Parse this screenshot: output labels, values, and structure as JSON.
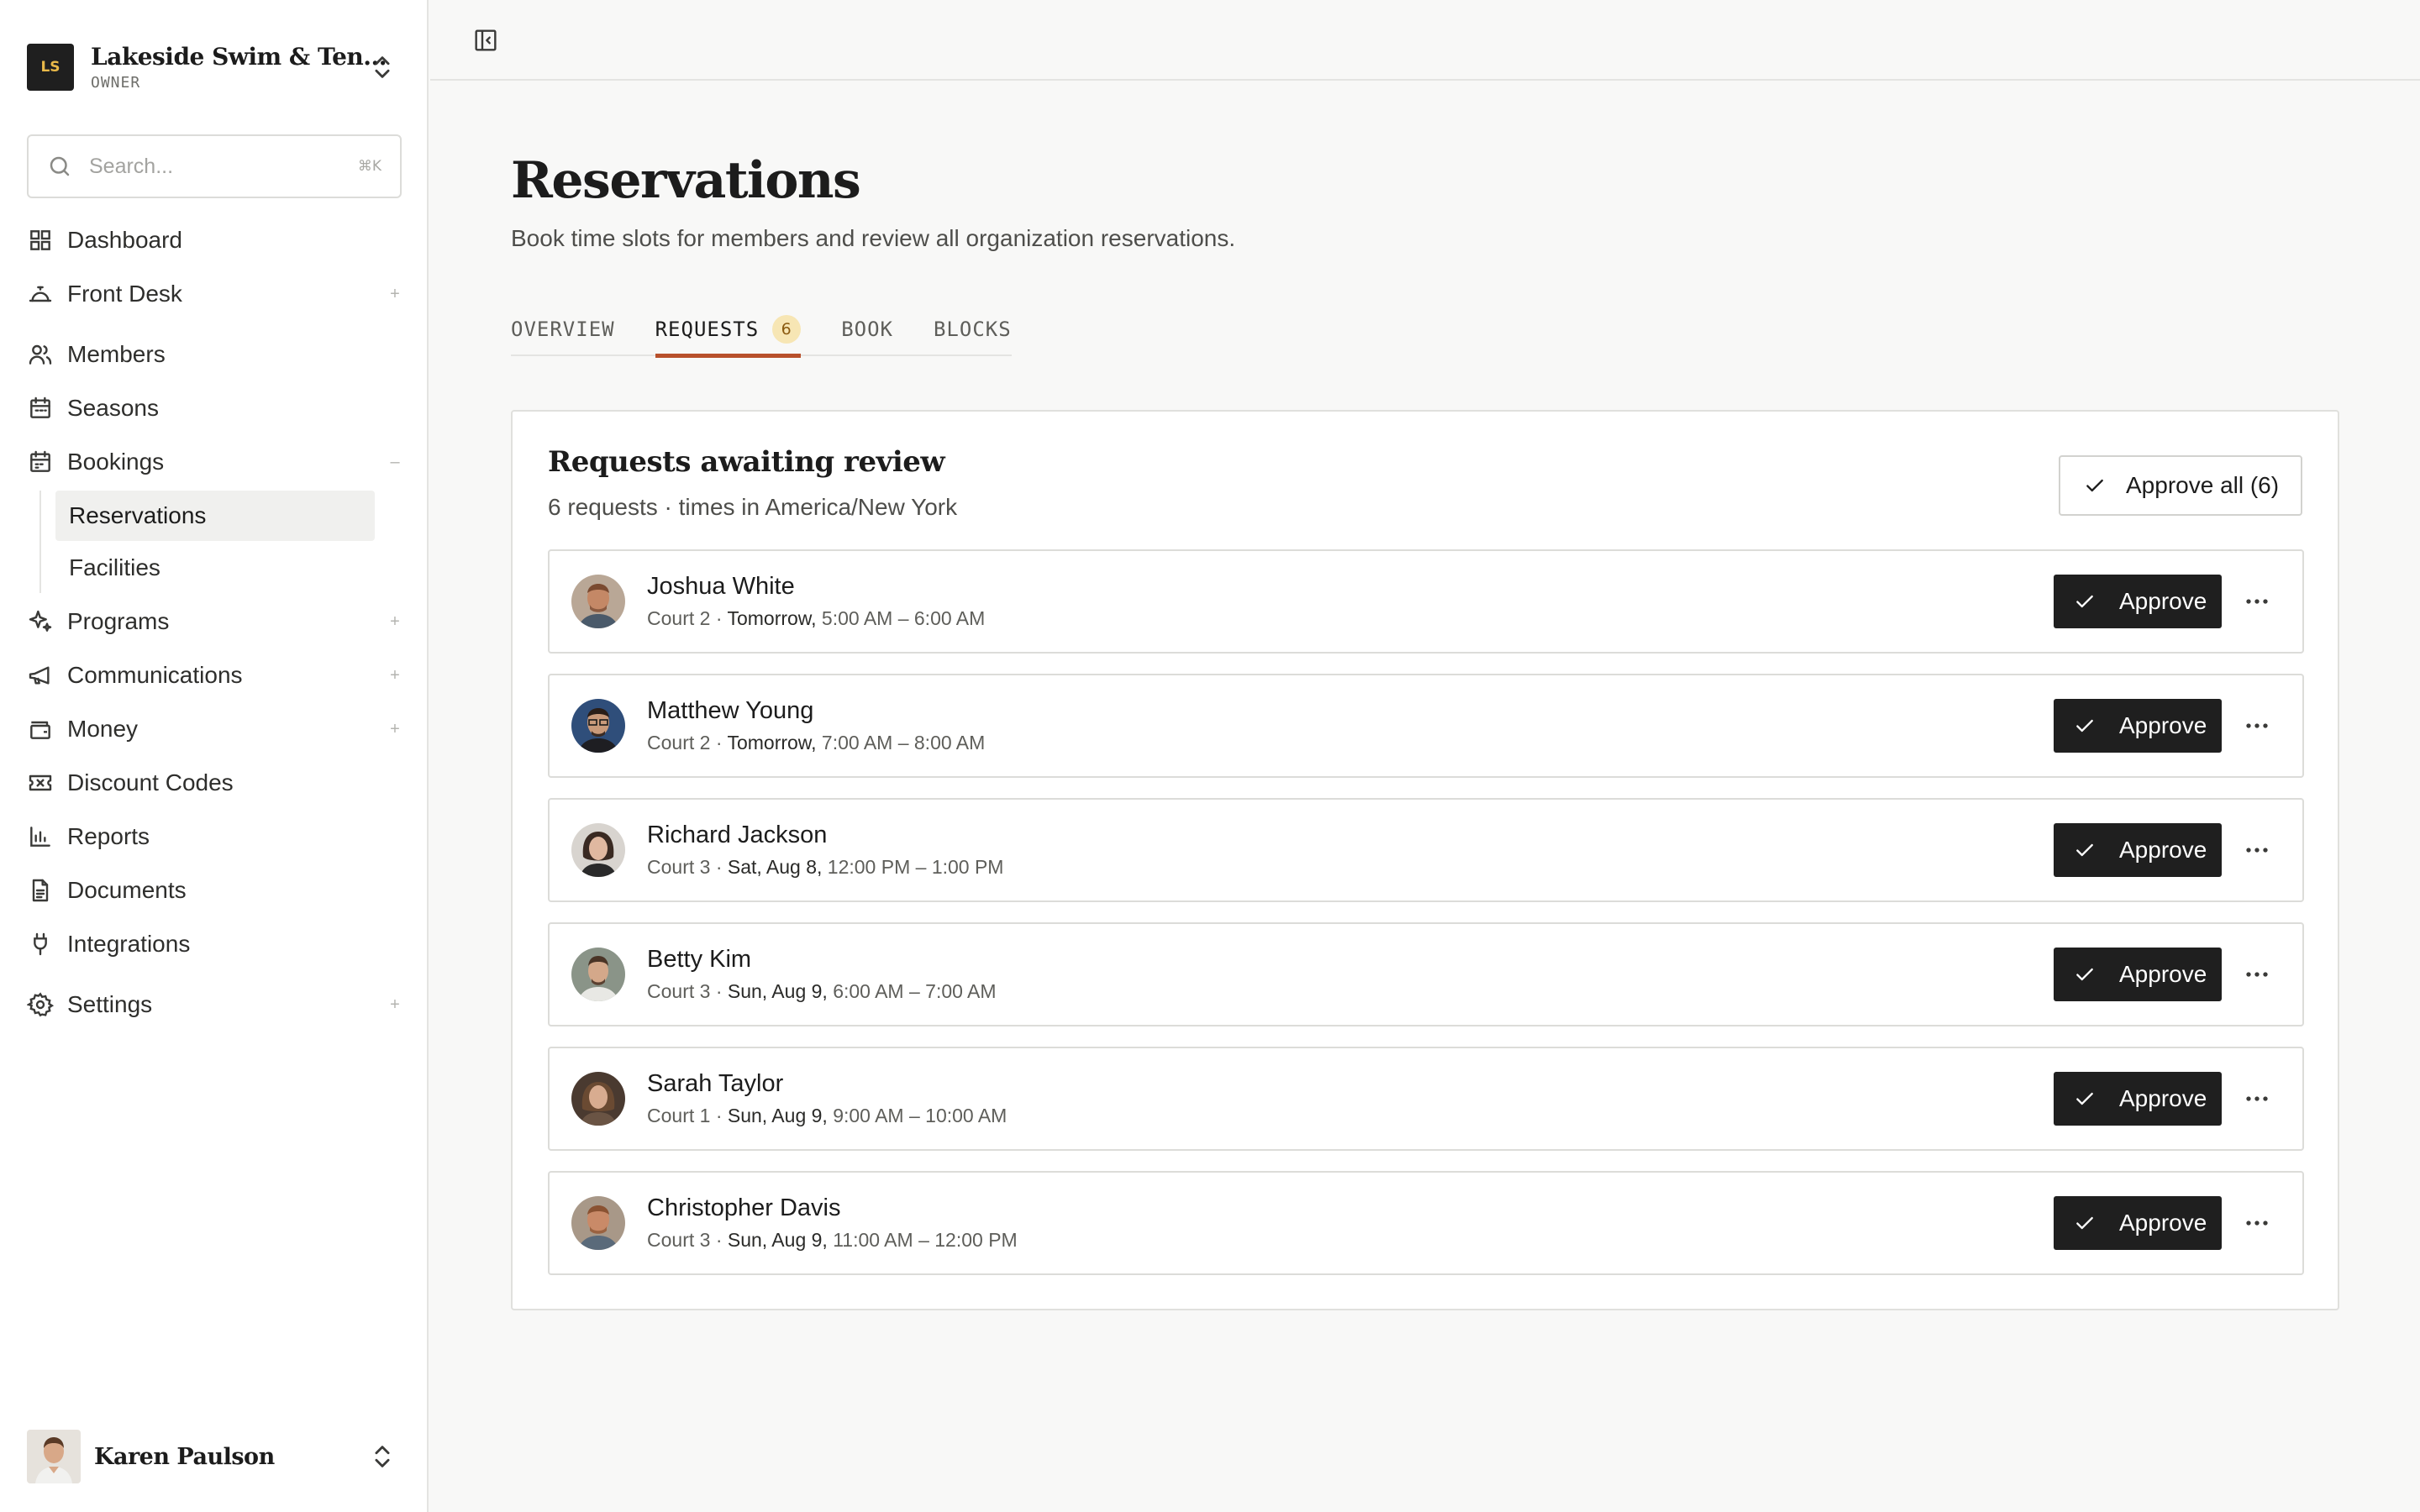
{
  "org": {
    "initials": "LS",
    "name": "Lakeside Swim & Ten...",
    "role": "OWNER"
  },
  "search": {
    "placeholder": "Search...",
    "shortcut": "⌘K"
  },
  "nav": {
    "dashboard": "Dashboard",
    "front_desk": "Front Desk",
    "members": "Members",
    "seasons": "Seasons",
    "bookings": "Bookings",
    "bookings_sub": [
      "Reservations",
      "Facilities"
    ],
    "programs": "Programs",
    "communications": "Communications",
    "money": "Money",
    "discount_codes": "Discount Codes",
    "reports": "Reports",
    "documents": "Documents",
    "integrations": "Integrations",
    "settings": "Settings",
    "expand_symbol": "+",
    "collapse_symbol": "–"
  },
  "user": {
    "name": "Karen Paulson"
  },
  "page": {
    "title": "Reservations",
    "subtitle": "Book time slots for members and review all organization reservations."
  },
  "tabs": [
    {
      "label": "OVERVIEW"
    },
    {
      "label": "REQUESTS",
      "badge": "6"
    },
    {
      "label": "BOOK"
    },
    {
      "label": "BLOCKS"
    }
  ],
  "card": {
    "title": "Requests awaiting review",
    "subtitle": "6 requests · times in America/New York",
    "approve_all": "Approve all (6)"
  },
  "requests": [
    {
      "name": "Joshua White",
      "court": "Court 2 · ",
      "when": "Tomorrow,",
      "time": " 5:00 AM – 6:00 AM",
      "approve": "Approve"
    },
    {
      "name": "Matthew Young",
      "court": "Court 2 · ",
      "when": "Tomorrow,",
      "time": " 7:00 AM – 8:00 AM",
      "approve": "Approve"
    },
    {
      "name": "Richard Jackson",
      "court": "Court 3 · ",
      "when": "Sat, Aug 8,",
      "time": " 12:00 PM – 1:00 PM",
      "approve": "Approve"
    },
    {
      "name": "Betty Kim",
      "court": "Court 3 · ",
      "when": "Sun, Aug 9,",
      "time": " 6:00 AM – 7:00 AM",
      "approve": "Approve"
    },
    {
      "name": "Sarah Taylor",
      "court": "Court 1 · ",
      "when": "Sun, Aug 9,",
      "time": " 9:00 AM – 10:00 AM",
      "approve": "Approve"
    },
    {
      "name": "Christopher Davis",
      "court": "Court 3 · ",
      "when": "Sun, Aug 9,",
      "time": " 11:00 AM – 12:00 PM",
      "approve": "Approve"
    }
  ],
  "colors": {
    "accent": "#b8502b",
    "badge_bg": "#f7e6b4",
    "button_dark": "#1f1f1f",
    "logo_text": "#e9b949"
  }
}
